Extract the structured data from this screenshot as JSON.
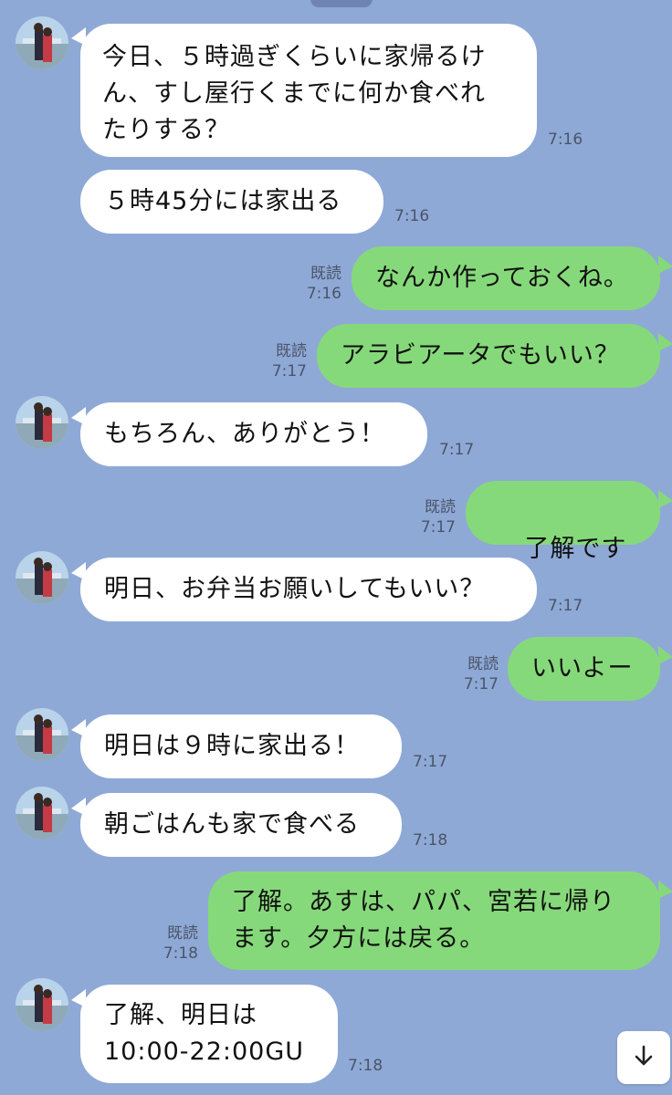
{
  "colors": {
    "background": "#8fa9d6",
    "incoming_bubble": "#ffffff",
    "outgoing_bubble": "#86d97a"
  },
  "messages": [
    {
      "side": "left",
      "text": "今日、５時過ぎくらいに家帰るけ\nん、すし屋行くまでに何か食べれ\nたりする？",
      "time": "7:16"
    },
    {
      "side": "left",
      "text": "５時45分には家出る",
      "time": "7:16"
    },
    {
      "side": "right",
      "text": "なんか作っておくね。",
      "read": "既読",
      "time": "7:16"
    },
    {
      "side": "right",
      "text": "アラビアータでもいい？",
      "read": "既読",
      "time": "7:17"
    },
    {
      "side": "left",
      "text": "もちろん、ありがとう！",
      "time": "7:17"
    },
    {
      "side": "right",
      "text": "了解です",
      "read": "既読",
      "time": "7:17",
      "emoji": "saluting-face-emoji"
    },
    {
      "side": "left",
      "text": "明日、お弁当お願いしてもいい？",
      "time": "7:17"
    },
    {
      "side": "right",
      "text": "いいよー",
      "read": "既読",
      "time": "7:17"
    },
    {
      "side": "left",
      "text": "明日は９時に家出る！",
      "time": "7:17"
    },
    {
      "side": "left",
      "text": "朝ごはんも家で食べる",
      "time": "7:18"
    },
    {
      "side": "right",
      "text": "了解。あすは、パパ、宮若に帰り\nます。夕方には戻る。",
      "read": "既読",
      "time": "7:18"
    },
    {
      "side": "left",
      "text": "了解、明日は\n10:00-22:00GU",
      "time": "7:18"
    }
  ],
  "scroll_button": {
    "icon": "arrow-down-icon"
  }
}
